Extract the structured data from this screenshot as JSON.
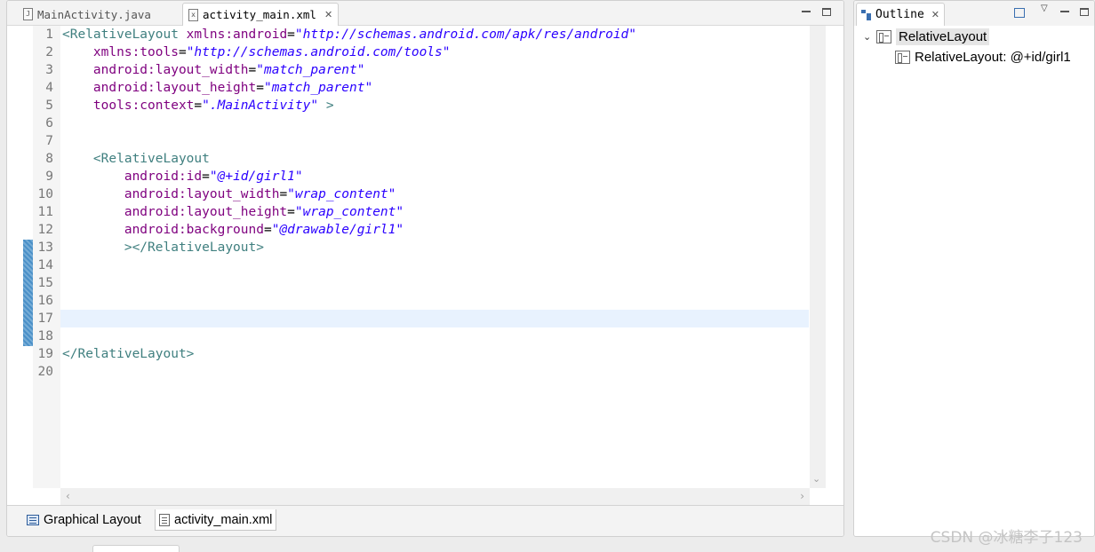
{
  "editor": {
    "tabs": [
      {
        "label": "MainActivity.java",
        "icon": "java-file-icon"
      },
      {
        "label": "activity_main.xml",
        "icon": "xml-file-icon",
        "active": true
      }
    ],
    "line_numbers": [
      "1",
      "2",
      "3",
      "4",
      "5",
      "6",
      "7",
      "8",
      "9",
      "10",
      "11",
      "12",
      "13",
      "14",
      "15",
      "16",
      "17",
      "18",
      "19",
      "20"
    ],
    "code": {
      "l1_tag": "<RelativeLayout",
      "l1_attr": " xmlns:android",
      "l1_eq": "=",
      "l1_val": "\"http://schemas.android.com/apk/res/android\"",
      "l2_attr": "    xmlns:tools",
      "l2_eq": "=",
      "l2_val": "\"http://schemas.android.com/tools\"",
      "l3_attr": "    android:layout_width",
      "l3_eq": "=",
      "l3_val": "\"match_parent\"",
      "l4_attr": "    android:layout_height",
      "l4_eq": "=",
      "l4_val": "\"match_parent\"",
      "l5_attr": "    tools:context",
      "l5_eq": "=",
      "l5_val": "\".MainActivity\"",
      "l5_close": " >",
      "l8_tag": "    <RelativeLayout",
      "l9_attr": "        android:id",
      "l9_eq": "=",
      "l9_val": "\"@+id/girl1\"",
      "l10_attr": "        android:layout_width",
      "l10_eq": "=",
      "l10_val": "\"wrap_content\"",
      "l11_attr": "        android:layout_height",
      "l11_eq": "=",
      "l11_val": "\"wrap_content\"",
      "l12_attr": "        android:background",
      "l12_eq": "=",
      "l12_val": "\"@drawable/girl1\"",
      "l13_tag": "        ></RelativeLayout>",
      "l19_tag": "</RelativeLayout>"
    },
    "bottom_tabs": {
      "graphical": "Graphical Layout",
      "xml": "activity_main.xml"
    }
  },
  "outline": {
    "title": "Outline",
    "root": "RelativeLayout",
    "child": "RelativeLayout: @+id/girl1"
  },
  "watermark": "CSDN @冰糖李子123",
  "colors": {
    "tag": "#3f7f7f",
    "attribute": "#7f007f",
    "value": "#2a00ff",
    "current_line": "#e8f2fe"
  }
}
